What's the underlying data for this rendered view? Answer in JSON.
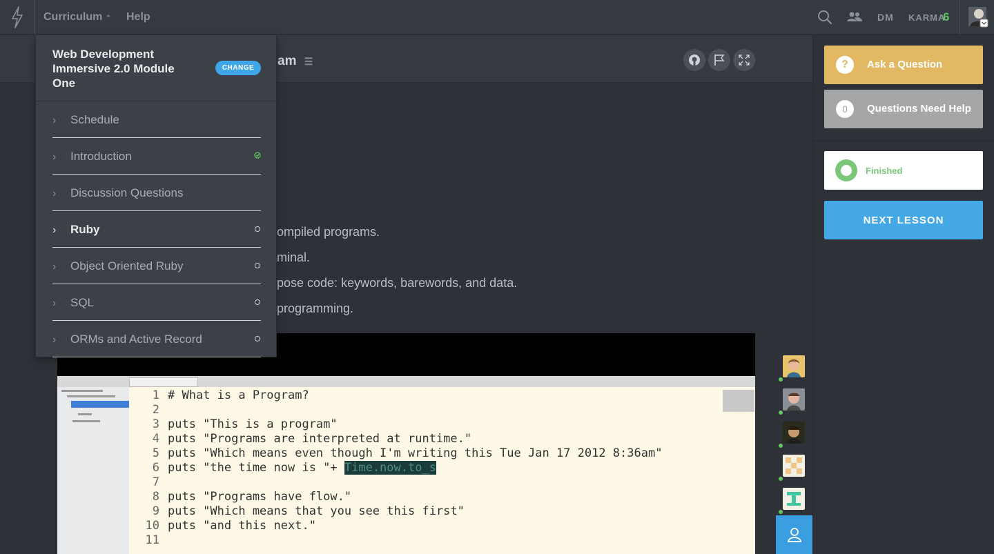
{
  "topnav": {
    "curriculum_label": "Curriculum",
    "help_label": "Help",
    "user_initials": "DM",
    "karma_label": "KARMA",
    "karma_value": "6"
  },
  "lesson": {
    "title_fragment": "am"
  },
  "objectives": [
    "ompiled programs.",
    "minal.",
    "pose code: keywords, barewords, and data.",
    "programming."
  ],
  "video": {
    "code_lines": [
      {
        "num": "1",
        "text": "# What is a Program?"
      },
      {
        "num": "2",
        "text": ""
      },
      {
        "num": "3",
        "text": "puts \"This is a program\""
      },
      {
        "num": "4",
        "text": "puts \"Programs are interpreted at runtime.\""
      },
      {
        "num": "5",
        "text": "puts \"Which means even though I'm writing this Tue Jan 17 2012 8:36am\""
      },
      {
        "num": "6",
        "text": "puts \"the time now is \"+ ",
        "highlight": "Time.now.to_s"
      },
      {
        "num": "7",
        "text": ""
      },
      {
        "num": "8",
        "text": "puts \"Programs have flow.\""
      },
      {
        "num": "9",
        "text": "puts \"Which means that you see this first\""
      },
      {
        "num": "10",
        "text": "puts \"and this next.\""
      },
      {
        "num": "11",
        "text": ""
      }
    ]
  },
  "sidebar": {
    "ask_label": "Ask a Question",
    "ask_icon": "?",
    "questions_count": "0",
    "questions_label": "Questions Need Help",
    "finished_label": "Finished",
    "next_label": "NEXT LESSON"
  },
  "dropdown": {
    "title": "Web Development Immersive 2.0 Module One",
    "change_label": "CHANGE",
    "items": [
      {
        "label": "Schedule",
        "status": "none"
      },
      {
        "label": "Introduction",
        "status": "complete"
      },
      {
        "label": "Discussion Questions",
        "status": "none"
      },
      {
        "label": "Ruby",
        "status": "incomplete",
        "active": true
      },
      {
        "label": "Object Oriented Ruby",
        "status": "incomplete"
      },
      {
        "label": "SQL",
        "status": "incomplete"
      },
      {
        "label": "ORMs and Active Record",
        "status": "incomplete"
      }
    ]
  },
  "colors": {
    "accent_blue": "#45a8e6",
    "ask_yellow": "#e3b863",
    "karma_green": "#62c462"
  }
}
